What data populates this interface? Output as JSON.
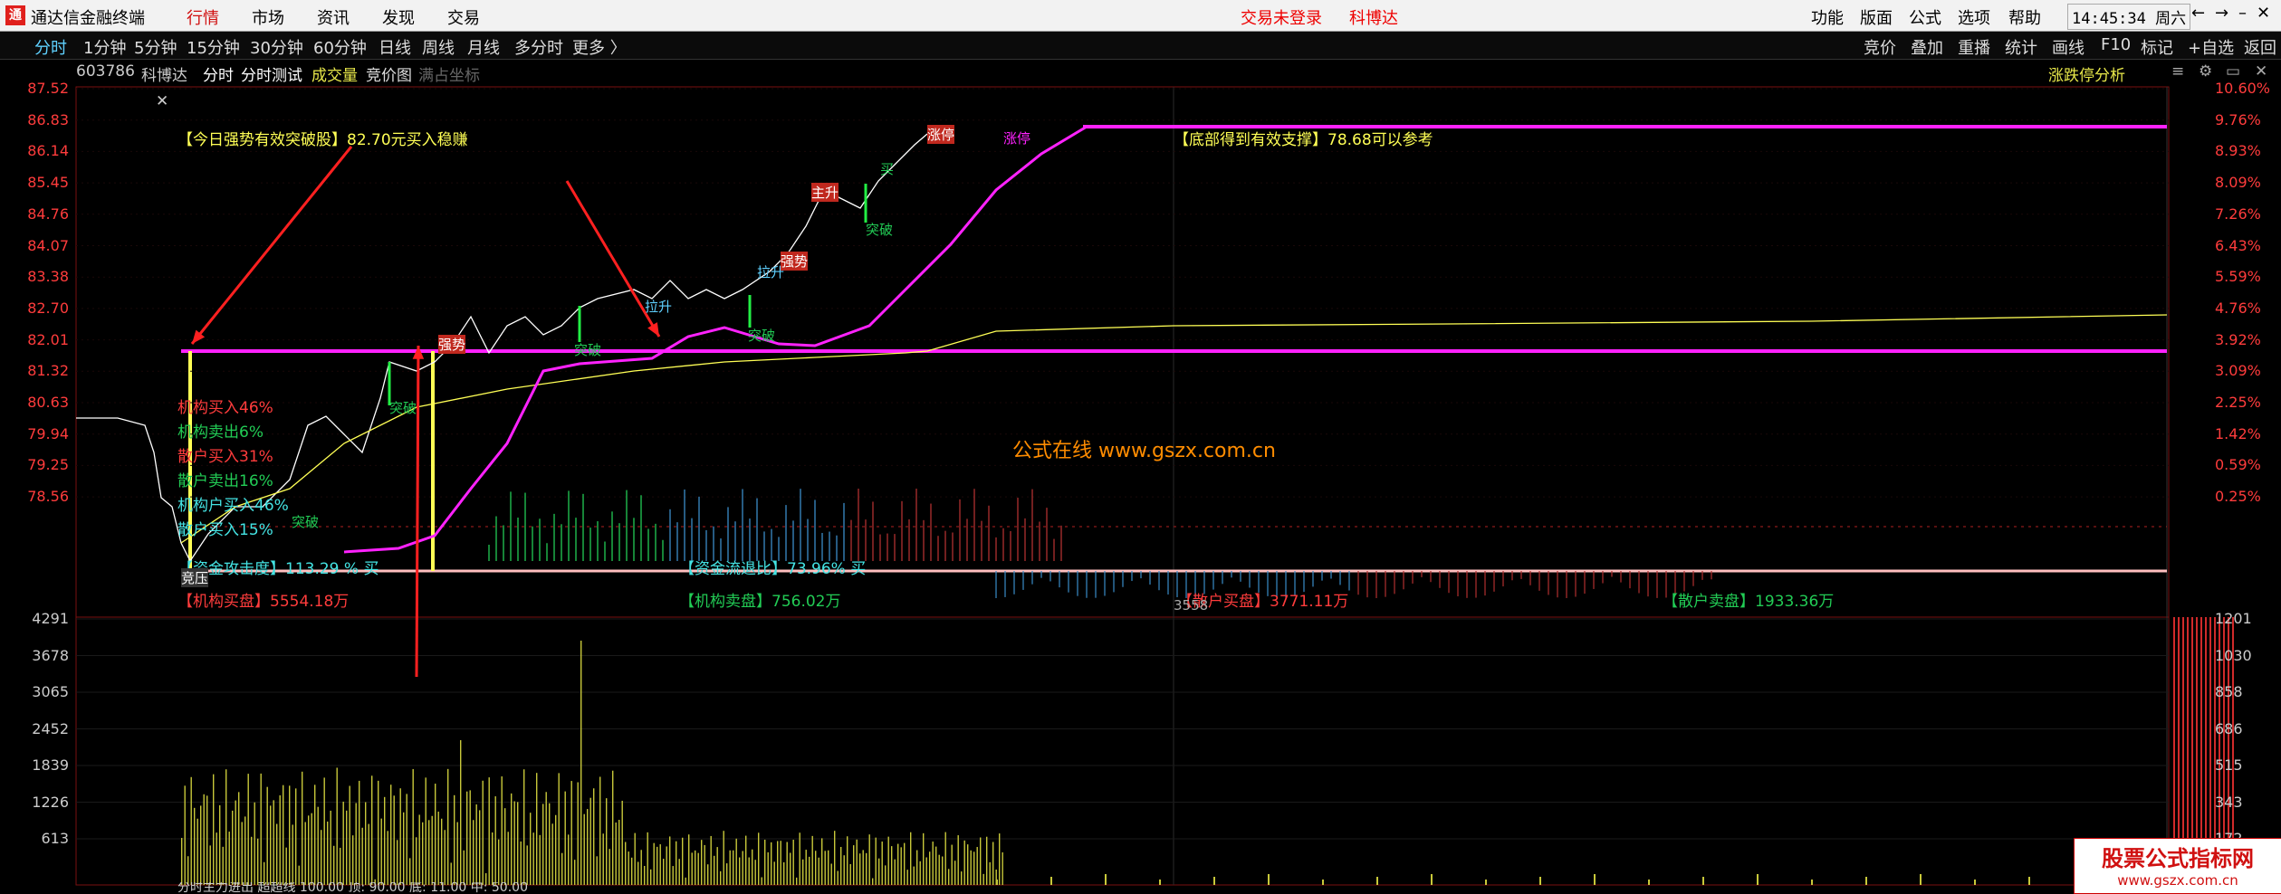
{
  "menubar": {
    "logo": "通",
    "app_name": "通达信金融终端",
    "items": [
      "行情",
      "市场",
      "资讯",
      "发现",
      "交易"
    ],
    "active_item": "行情",
    "login_status": "交易未登录",
    "stock_name_title": "科博达",
    "right_items": [
      "功能",
      "版面",
      "公式",
      "选项",
      "帮助"
    ],
    "clock": "14:45:34",
    "weekday": "周六"
  },
  "periodbar": {
    "tabs": [
      "分时",
      "1分钟",
      "5分钟",
      "15分钟",
      "30分钟",
      "60分钟",
      "日线",
      "周线",
      "月线",
      "多分时",
      "更多 〉"
    ],
    "active_tab": "分时",
    "tools": [
      "竞价",
      "叠加",
      "重播",
      "统计",
      "画线",
      "F10",
      "标记",
      "+自选",
      "返回"
    ]
  },
  "infobar": {
    "code": "603786",
    "name": "科博达",
    "view": "分时",
    "test": "分时测试",
    "volume": "成交量",
    "bid_chart": "竞价图",
    "full_coord": "满占坐标",
    "limit_analysis": "涨跌停分析"
  },
  "price_axis": [
    "87.52",
    "86.83",
    "86.14",
    "85.45",
    "84.76",
    "84.07",
    "83.38",
    "82.70",
    "82.01",
    "81.32",
    "80.63",
    "79.94",
    "79.25",
    "78.56"
  ],
  "pct_axis": [
    "10.60%",
    "9.76%",
    "8.93%",
    "8.09%",
    "7.26%",
    "6.43%",
    "5.59%",
    "4.76%",
    "3.92%",
    "3.09%",
    "2.25%",
    "1.42%",
    "0.59%",
    "0.25%"
  ],
  "vol_axis_left": [
    "4291",
    "3678",
    "3065",
    "2452",
    "1839",
    "1226",
    "613"
  ],
  "vol_axis_right": [
    "1201",
    "1030",
    "858",
    "686",
    "515",
    "343",
    "172"
  ],
  "annotations": {
    "breakout": "【今日强势有效突破股】82.70元买入稳赚",
    "support": "【底部得到有效支撑】78.68可以参考",
    "inst_buy_pct": "机构买入46%",
    "inst_sell_pct": "机构卖出6%",
    "retail_buy_pct": "散户买入31%",
    "retail_sell_pct": "散户卖出16%",
    "inst_net": "机构户买入46%",
    "retail_net": "散户买入15%",
    "fund_attack": "【资金攻击度】113.29 % 买",
    "fund_flow": "【资金流退比】73.96% 买",
    "inst_buy_amt": "【机构买盘】5554.18万",
    "inst_sell_amt": "【机构卖盘】756.02万",
    "retail_buy_amt": "【散户买盘】3771.11万",
    "retail_sell_amt": "【散户卖盘】1933.36万",
    "auction": "竞压",
    "vol_marker": "3558",
    "watermark": "公式在线 www.gszx.com.cn",
    "limit_up": "涨停",
    "limit_up2": "涨停",
    "tag_breakout": "突破",
    "tag_strong": "强势",
    "tag_rise": "拉升",
    "tag_pull": "拉升",
    "tag_main": "主升",
    "tag_buy": "买"
  },
  "bottom_line": "分时主力进出  超超线  100.00  顶: 90.00  底: 11.00  中: 50.00",
  "corner_logo": {
    "line1": "股票公式指标网",
    "line2": "www.gszx.com.cn"
  },
  "colors": {
    "up": "#ff3c3c",
    "down": "#22cc55",
    "price_line": "#ffffff",
    "avg_line": "#ffff55",
    "magenta": "#ff22ff"
  }
}
